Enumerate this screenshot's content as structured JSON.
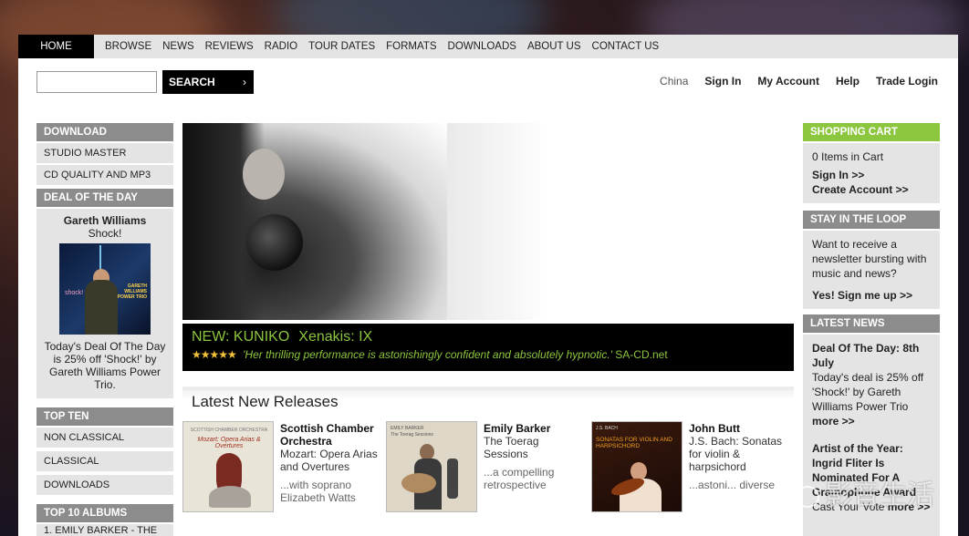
{
  "nav": {
    "items": [
      "HOME",
      "BROWSE",
      "NEWS",
      "REVIEWS",
      "RADIO",
      "TOUR DATES",
      "FORMATS",
      "DOWNLOADS",
      "ABOUT US",
      "CONTACT US"
    ]
  },
  "search": {
    "value": "",
    "button_label": "SEARCH",
    "chevron": "›"
  },
  "account": {
    "region": "China",
    "sign_in": "Sign In",
    "my_account": "My Account",
    "help": "Help",
    "trade_login": "Trade Login"
  },
  "left": {
    "download": {
      "heading": "DOWNLOAD",
      "items": [
        "STUDIO MASTER",
        "CD QUALITY AND MP3"
      ]
    },
    "deal": {
      "heading": "DEAL OF THE DAY",
      "artist": "Gareth Williams",
      "album": "Shock!",
      "cover_text_left": "shock!",
      "cover_text_right": "GARETH WILLIAMS POWER TRIO",
      "description": "Today's Deal Of The Day is 25% off 'Shock!' by Gareth Williams Power Trio."
    },
    "top_ten": {
      "heading": "TOP TEN",
      "items": [
        "NON CLASSICAL",
        "CLASSICAL",
        "DOWNLOADS"
      ]
    },
    "top_albums": {
      "heading": "TOP 10 ALBUMS",
      "first_item": "1.    Emily Barker - The"
    }
  },
  "hero": {
    "new_label": "NEW: KUNIKO",
    "work": "Xenakis: IX",
    "stars": "★★★★★",
    "quote": "'Her thrilling performance is astonishingly confident and absolutely hypnotic.'",
    "source": "SA-CD.net"
  },
  "releases": {
    "heading": "Latest New Releases",
    "items": [
      {
        "artist": "Scottish Chamber Orchestra",
        "album": "Mozart: Opera Arias and Overtures",
        "blurb": "...with soprano Elizabeth Watts",
        "cover_top": "SCOTTISH CHAMBER ORCHESTRA",
        "cover_title": "Mozart: Opera Arias & Overtures"
      },
      {
        "artist": "Emily Barker",
        "album": "The Toerag Sessions",
        "blurb": "...a compelling retrospective",
        "cover_top": "EMILY BARKER",
        "cover_title": "The Toerag Sessions"
      },
      {
        "artist": "John Butt",
        "album": "J.S. Bach: Sonatas for violin & harpsichord",
        "blurb": "...astoni... diverse",
        "cover_top": "J.S. BACH",
        "cover_title": "SONATAS FOR VIOLIN AND HARPSICHORD"
      }
    ]
  },
  "right": {
    "cart": {
      "heading": "SHOPPING CART",
      "items": "0 Items in Cart",
      "sign_in": "Sign In >>",
      "create": "Create Account >>"
    },
    "loop": {
      "heading": "STAY IN THE LOOP",
      "text": "Want to receive a newsletter bursting with music and news?",
      "link": "Yes! Sign me up >>"
    },
    "news": {
      "heading": "LATEST NEWS",
      "items": [
        {
          "title": "Deal Of The Day: 8th July",
          "body": "Today's deal is 25% off 'Shock!' by Gareth Williams Power Trio",
          "more": "more >>"
        },
        {
          "title": "Artist of the Year: Ingrid Fliter Is Nominated For A Gramophone Award",
          "body": "Cast Your Vote",
          "more": "more >>"
        }
      ]
    }
  },
  "watermark": "影音生活",
  "colors": {
    "accent_green": "#8cc63f",
    "bar_gray": "#8c8c8c",
    "star_gold": "#f2c13b"
  }
}
